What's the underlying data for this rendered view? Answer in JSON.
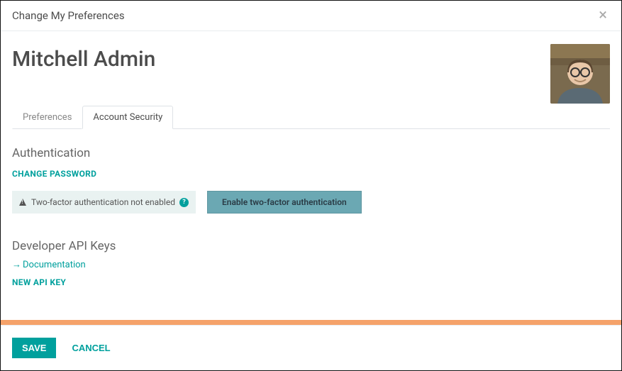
{
  "modal": {
    "title": "Change My Preferences",
    "close_glyph": "×"
  },
  "user": {
    "name": "Mitchell Admin"
  },
  "tabs": {
    "preferences": "Preferences",
    "account_security": "Account Security",
    "active": "account_security"
  },
  "authentication": {
    "heading": "Authentication",
    "change_password": "CHANGE PASSWORD",
    "twofa_status": "Two-factor authentication not enabled",
    "help_glyph": "?",
    "enable_button": "Enable two-factor authentication"
  },
  "api_keys": {
    "heading": "Developer API Keys",
    "doc_link": "Documentation",
    "doc_arrow": "→",
    "new_key": "NEW API KEY"
  },
  "footer": {
    "save": "SAVE",
    "cancel": "CANCEL"
  },
  "colors": {
    "primary": "#00a09d",
    "accent_bar": "#f5a26a",
    "enable_btn": "#6ba8b3"
  }
}
